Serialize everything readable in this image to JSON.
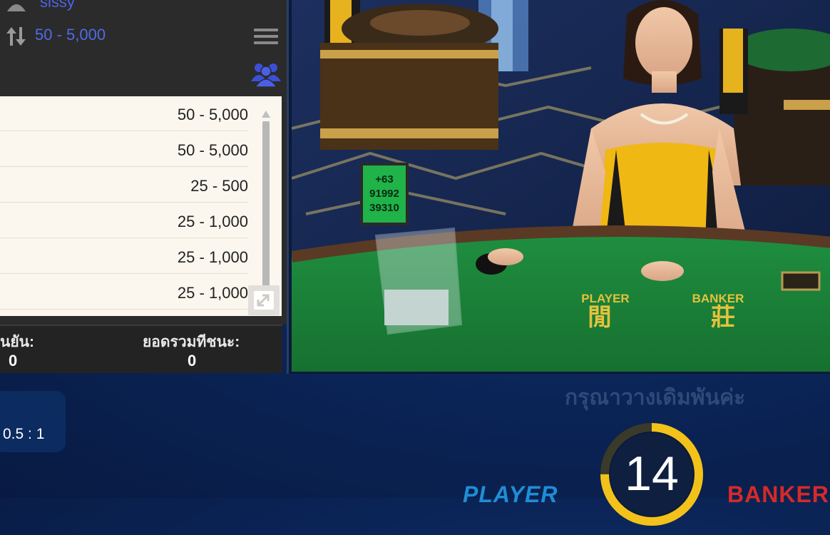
{
  "user": {
    "name": "sissy"
  },
  "table_limit": "50 - 5,000",
  "limit_list": [
    "50 - 5,000",
    "50 - 5,000",
    "25 - 500",
    "25 - 1,000",
    "25 - 1,000",
    "25 - 1,000"
  ],
  "summary": {
    "confirmed_label": "นยัน:",
    "confirmed_value": "0",
    "total_win_label": "ยอดรวมทีชนะ:",
    "total_win_value": "0"
  },
  "video": {
    "card_text": [
      "+63",
      "91992",
      "39310"
    ],
    "table_player_text": "PLAYER",
    "table_banker_text": "BANKER",
    "table_player_char": "閒",
    "table_banker_char": "莊"
  },
  "payout_ratio": "0.5 : 1",
  "bet_prompt": "กรุณาวางเดิมพันค่ะ",
  "countdown": {
    "seconds": "14",
    "fraction_remaining": 0.75
  },
  "bet_labels": {
    "player": "PLAYER",
    "banker": "BANKER"
  },
  "colors": {
    "accent_blue": "#4f6be8",
    "timer_ring": "#f2c21b",
    "player": "#1f8dd6",
    "banker": "#d42a2a",
    "felt_green": "#1e8a3c"
  }
}
